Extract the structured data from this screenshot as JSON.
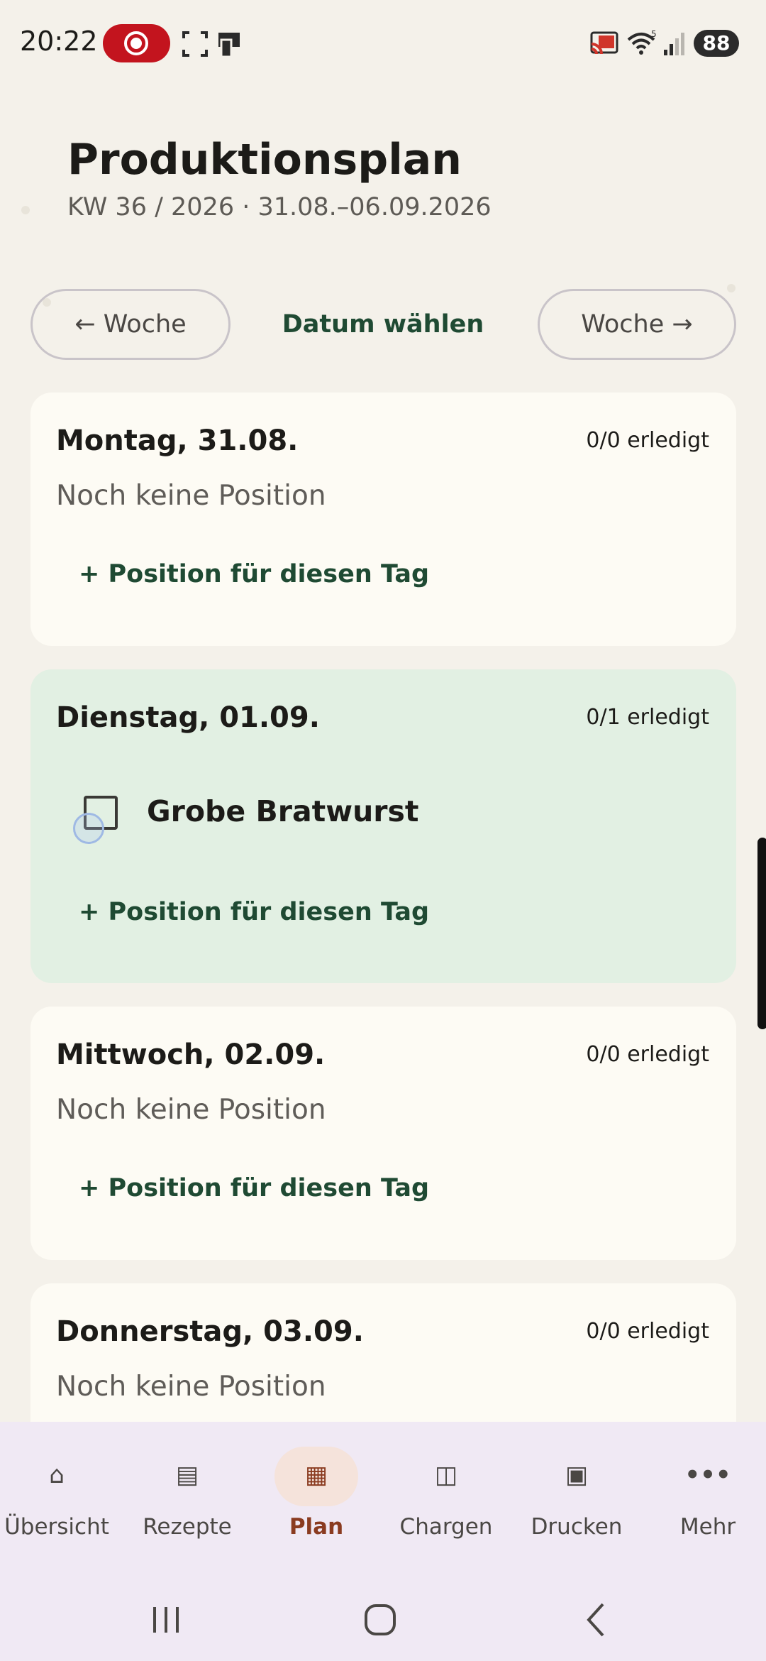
{
  "status_bar": {
    "time": "20:22",
    "battery": "88",
    "icons": [
      "screen-record-icon",
      "screenshot-frame-icon",
      "device-icon",
      "cast-icon",
      "wifi-icon",
      "signal-icon",
      "battery-icon"
    ]
  },
  "header": {
    "title": "Produktionsplan",
    "subtitle": "KW 36 / 2026 · 31.08.–06.09.2026"
  },
  "week_nav": {
    "prev_label": "← Woche",
    "pick_label": "Datum wählen",
    "next_label": "Woche →"
  },
  "days": [
    {
      "title": "Montag, 31.08.",
      "count": "0/0 erledigt",
      "empty_text": "Noch keine Position",
      "add_label": "+ Position für diesen Tag"
    },
    {
      "title": "Dienstag, 01.09.",
      "count": "0/1 erledigt",
      "items": [
        {
          "name": "Grobe Bratwurst",
          "checked": false
        }
      ],
      "add_label": "+ Position für diesen Tag",
      "highlighted": true
    },
    {
      "title": "Mittwoch, 02.09.",
      "count": "0/0 erledigt",
      "empty_text": "Noch keine Position",
      "add_label": "+ Position für diesen Tag"
    },
    {
      "title": "Donnerstag, 03.09.",
      "count": "0/0 erledigt",
      "empty_text": "Noch keine Position"
    }
  ],
  "bottom_nav": {
    "items": [
      {
        "label": "Übersicht",
        "icon": "home-icon",
        "glyph": "⌂"
      },
      {
        "label": "Rezepte",
        "icon": "list-icon",
        "glyph": "▤"
      },
      {
        "label": "Plan",
        "icon": "calendar-grid-icon",
        "glyph": "▦",
        "active": true
      },
      {
        "label": "Chargen",
        "icon": "batch-icon",
        "glyph": "◫"
      },
      {
        "label": "Drucken",
        "icon": "print-icon",
        "glyph": "▣"
      },
      {
        "label": "Mehr",
        "icon": "more-icon",
        "glyph": "•••"
      }
    ]
  },
  "colors": {
    "background": "#f4f1ea",
    "card": "#fdfbf4",
    "card_today": "#e2f0e3",
    "accent_green": "#1f4a33",
    "active_nav": "#8a3b20",
    "nav_bg": "#f0e9f4"
  }
}
